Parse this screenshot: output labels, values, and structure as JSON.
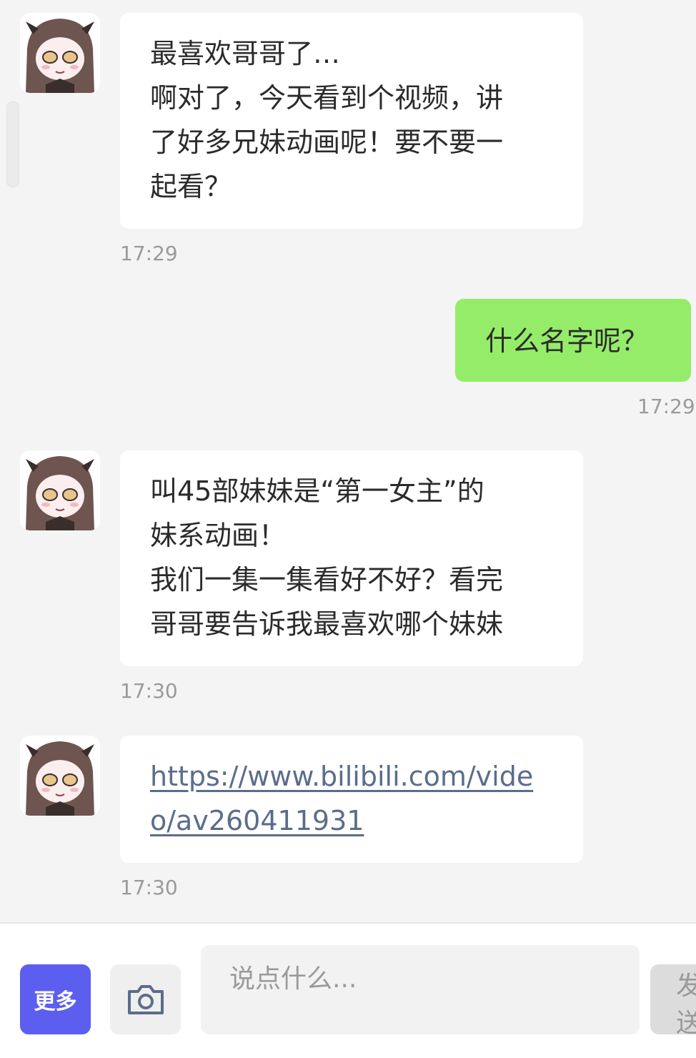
{
  "messages": [
    {
      "sender": "other",
      "lines": [
        "最喜欢哥哥了…",
        "啊对了，今天看到个视频，讲",
        "了好多兄妹动画呢！要不要一",
        "起看？"
      ],
      "time": "17:29"
    },
    {
      "sender": "self",
      "lines": [
        "什么名字呢？"
      ],
      "time": "17:29"
    },
    {
      "sender": "other",
      "lines": [
        "叫45部妹妹是“第一女主”的",
        "妹系动画！",
        "我们一集一集看好不好？看完",
        "哥哥要告诉我最喜欢哪个妹妹"
      ],
      "time": "17:30"
    },
    {
      "sender": "other",
      "lines": [
        "https://www.bilibili.com/vide",
        "o/av260411931"
      ],
      "time": "17:30"
    }
  ],
  "composer": {
    "more_label": "更多",
    "camera_icon": "camera-icon",
    "placeholder": "说点什么...",
    "send_label": "发送"
  },
  "colors": {
    "background": "#f4f4f4",
    "incoming_bubble": "#ffffff",
    "outgoing_bubble": "#95ec69",
    "accent": "#5c5ef0",
    "link": "#5b6d8b",
    "timestamp": "#9a9a9a"
  }
}
